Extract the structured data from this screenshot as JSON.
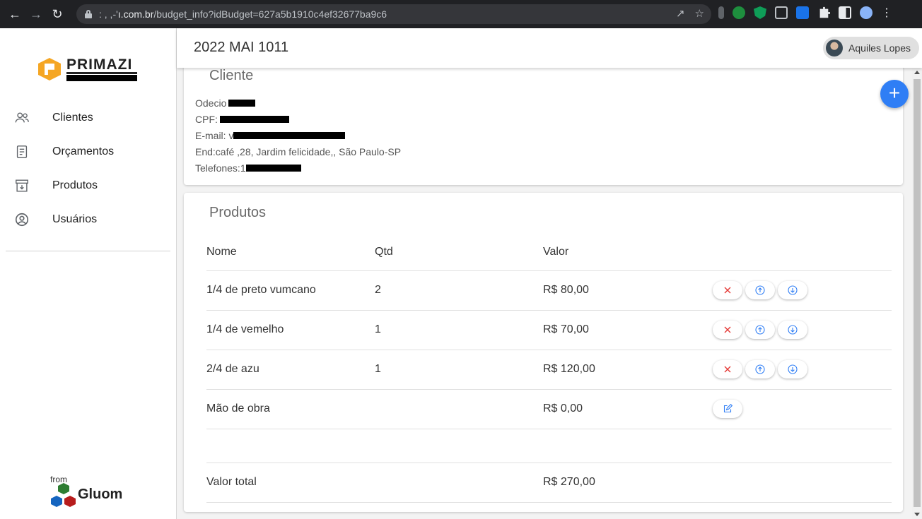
{
  "browser": {
    "url_prefix": ": , ,-'",
    "url_host": "ı.com.br",
    "url_path": "/budget_info?idBudget=627a5b1910c4ef32677ba9c6"
  },
  "sidebar": {
    "logo_text": "PRIMAZI",
    "items": [
      {
        "label": "Clientes",
        "icon": "users-icon"
      },
      {
        "label": "Orçamentos",
        "icon": "document-icon"
      },
      {
        "label": "Produtos",
        "icon": "archive-icon"
      },
      {
        "label": "Usuários",
        "icon": "user-circle-icon"
      }
    ],
    "footer_from": "from",
    "footer_brand": "Gluom"
  },
  "header": {
    "title": "2022 MAI 1011",
    "user_name": "Aquiles Lopes"
  },
  "client": {
    "title": "Cliente",
    "name_label": "Odecio",
    "cpf_label": "CPF:",
    "email_label": "E-mail:",
    "email_prefix": "v",
    "address": "End:café ,28, Jardim felicidade,, São Paulo-SP",
    "phone_label": "Telefones:",
    "phone_prefix": "1"
  },
  "products": {
    "title": "Produtos",
    "columns": {
      "nome": "Nome",
      "qtd": "Qtd",
      "valor": "Valor"
    },
    "rows": [
      {
        "nome": "1/4 de preto vumcano",
        "qtd": "2",
        "valor": "R$ 80,00"
      },
      {
        "nome": "1/4 de vemelho",
        "qtd": "1",
        "valor": "R$ 70,00"
      },
      {
        "nome": "2/4 de azu",
        "qtd": "1",
        "valor": "R$ 120,00"
      }
    ],
    "labor": {
      "nome": "Mão de obra",
      "valor": "R$ 0,00"
    },
    "total": {
      "label": "Valor total",
      "valor": "R$ 270,00"
    }
  },
  "colors": {
    "accent": "#2f7ef5",
    "delete": "#e53935",
    "brand_orange": "#f5a623"
  }
}
